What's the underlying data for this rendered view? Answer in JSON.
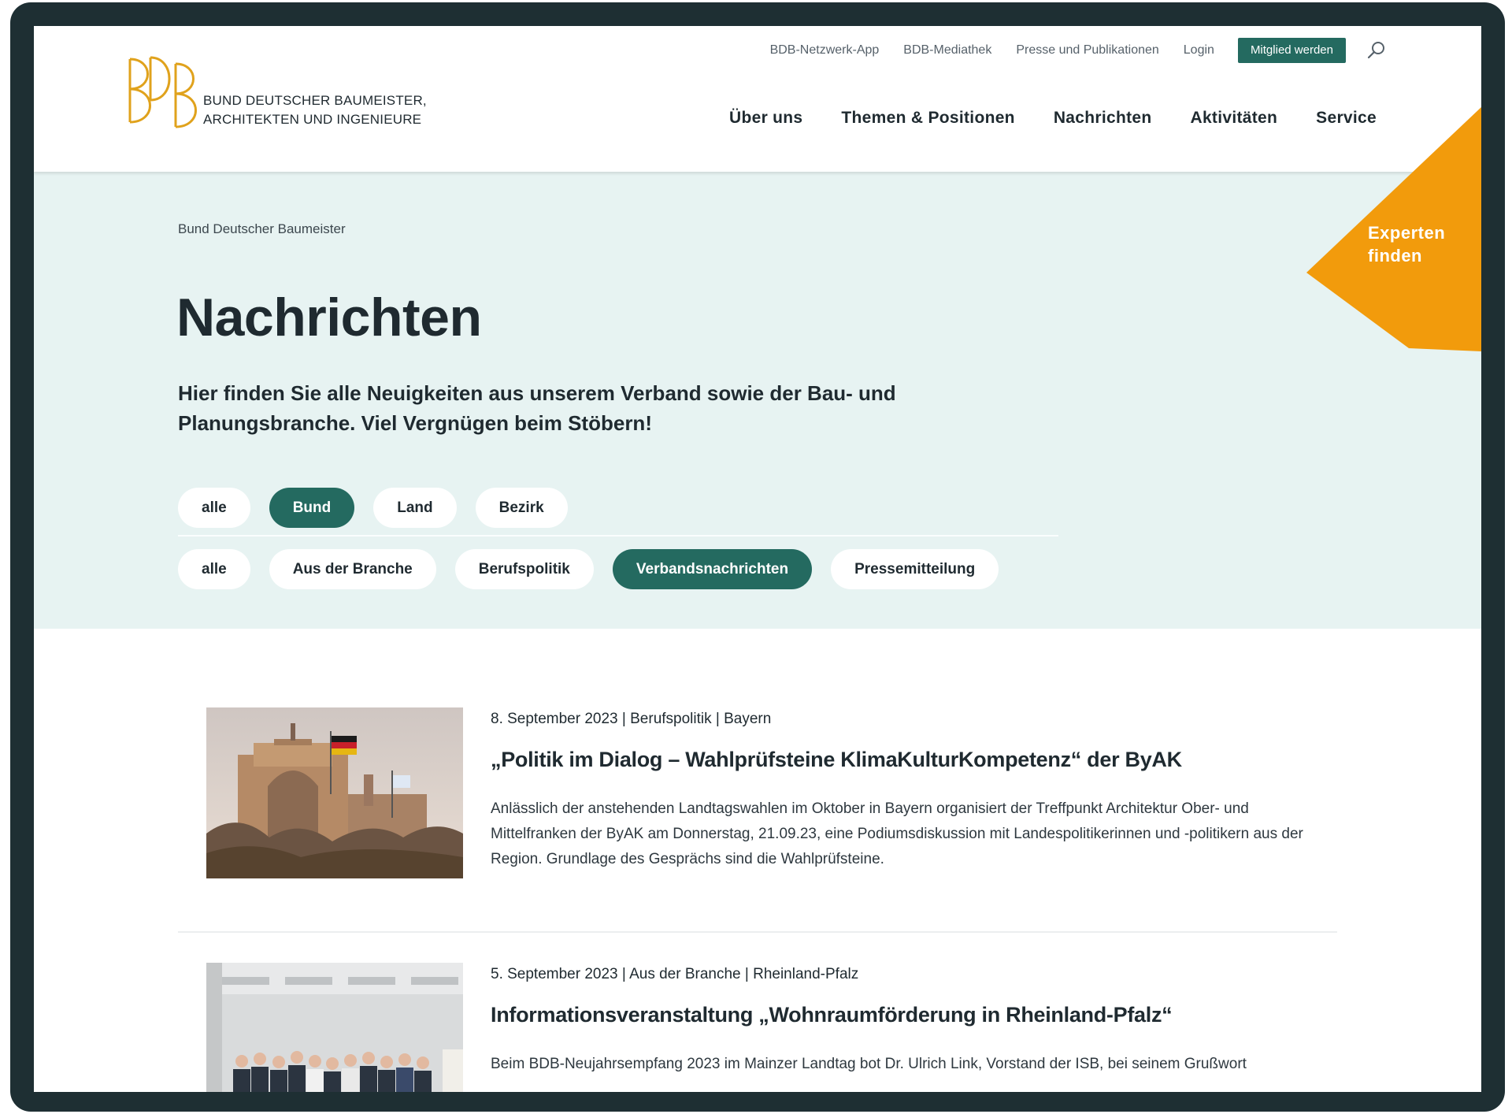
{
  "header": {
    "logo_mark": "BDB",
    "logo_line1": "BUND DEUTSCHER BAUMEISTER,",
    "logo_line2": "ARCHITEKTEN UND INGENIEURE",
    "top_links": [
      "BDB-Netzwerk-App",
      "BDB-Mediathek",
      "Presse und Publikationen",
      "Login"
    ],
    "cta": "Mitglied werden",
    "main_nav": [
      "Über uns",
      "Themen & Positionen",
      "Nachrichten",
      "Aktivitäten",
      "Service"
    ]
  },
  "hero": {
    "breadcrumb": "Bund Deutscher Baumeister",
    "title": "Nachrichten",
    "lead": "Hier finden Sie alle Neuigkeiten aus unserem Verband sowie der Bau- und Planungsbranche. Viel Vergnügen beim Stöbern!",
    "filter_level": [
      {
        "label": "alle",
        "active": false
      },
      {
        "label": "Bund",
        "active": true
      },
      {
        "label": "Land",
        "active": false
      },
      {
        "label": "Bezirk",
        "active": false
      }
    ],
    "filter_category": [
      {
        "label": "alle",
        "active": false
      },
      {
        "label": "Aus der Branche",
        "active": false
      },
      {
        "label": "Berufspolitik",
        "active": false
      },
      {
        "label": "Verbandsnachrichten",
        "active": true
      },
      {
        "label": "Pressemitteilung",
        "active": false
      }
    ],
    "badge_line1": "Experten",
    "badge_line2": "finden"
  },
  "colors": {
    "accent": "#246a60",
    "badge": "#f29b0c",
    "logo": "#e0a21c",
    "hero_bg": "#e7f3f2"
  },
  "news": [
    {
      "date": "8. September 2023",
      "category": "Berufspolitik",
      "region": "Bayern",
      "title": "„Politik im Dialog – Wahlprüfsteine KlimaKulturKompetenz“ der ByAK",
      "teaser": "Anlässlich der anstehenden Landtagswahlen im Oktober in Bayern organisiert der Treffpunkt Architektur Ober- und Mittelfranken der ByAK am Donnerstag, 21.09.23, eine Podiumsdiskussion mit Landespolitikerinnen und -politikern aus der Region. Grundlage des Gesprächs sind die Wahlprüfsteine."
    },
    {
      "date": "5. September 2023",
      "category": "Aus der Branche",
      "region": "Rheinland-Pfalz",
      "title": "Informationsveranstaltung „Wohnraumförderung in Rheinland-Pfalz“",
      "teaser": "Beim BDB-Neujahrsempfang 2023 im Mainzer Landtag bot Dr. Ulrich Link, Vorstand der ISB, bei seinem Grußwort"
    }
  ]
}
